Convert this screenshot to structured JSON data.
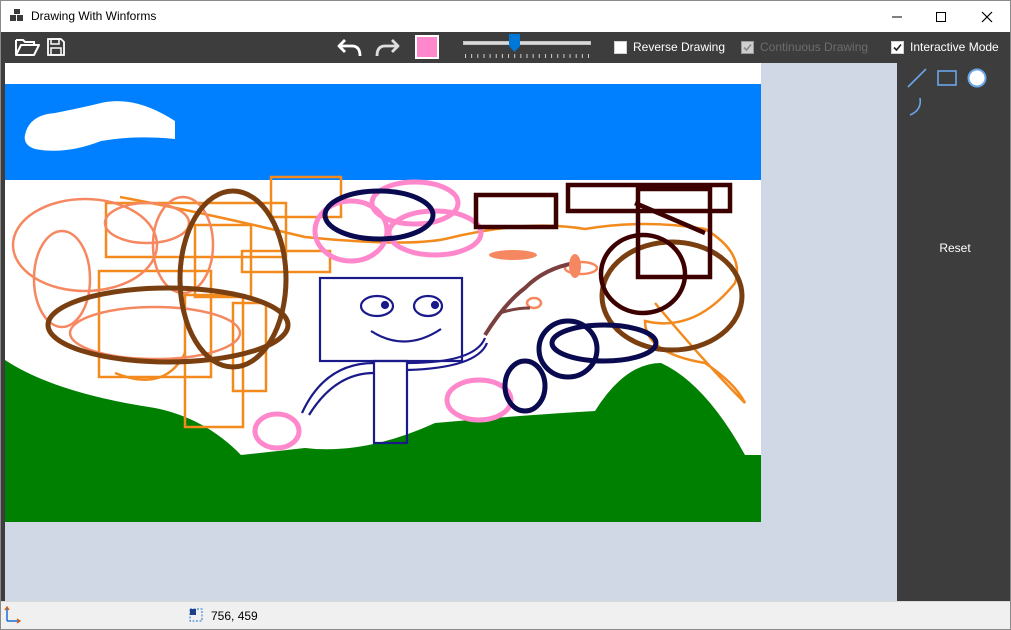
{
  "window": {
    "title": "Drawing With Winforms"
  },
  "toolbar": {
    "open_icon": "folder-open-icon",
    "save_icon": "save-icon",
    "undo_icon": "undo-icon",
    "redo_icon": "redo-icon",
    "current_color": "#ff88cc",
    "brush_size_slider": {
      "min": 0,
      "max": 20,
      "value": 8
    },
    "checkboxes": {
      "reverse_drawing": {
        "label": "Reverse Drawing",
        "checked": false,
        "enabled": true
      },
      "continuous_drawing": {
        "label": "Continuous Drawing",
        "checked": true,
        "enabled": false
      },
      "interactive_mode": {
        "label": "Interactive Mode",
        "checked": true,
        "enabled": true
      }
    }
  },
  "side_panel": {
    "tools": [
      {
        "name": "line-tool-icon",
        "selected": false
      },
      {
        "name": "rectangle-tool-icon",
        "selected": false
      },
      {
        "name": "ellipse-tool-icon",
        "selected": true
      },
      {
        "name": "arc-tool-icon",
        "selected": false
      }
    ],
    "reset_label": "Reset"
  },
  "status": {
    "canvas_size": "756, 459"
  },
  "colors": {
    "sky": "#0080ff",
    "grass": "#008000",
    "toolbar_bg": "#3d3d3d",
    "canvas_bg": "#cfd8e4",
    "pink": "#ff88cc",
    "orange": "#f28a1e",
    "brown": "#7a3f10",
    "navy": "#0a0a50",
    "dark_maroon": "#3d0000"
  }
}
